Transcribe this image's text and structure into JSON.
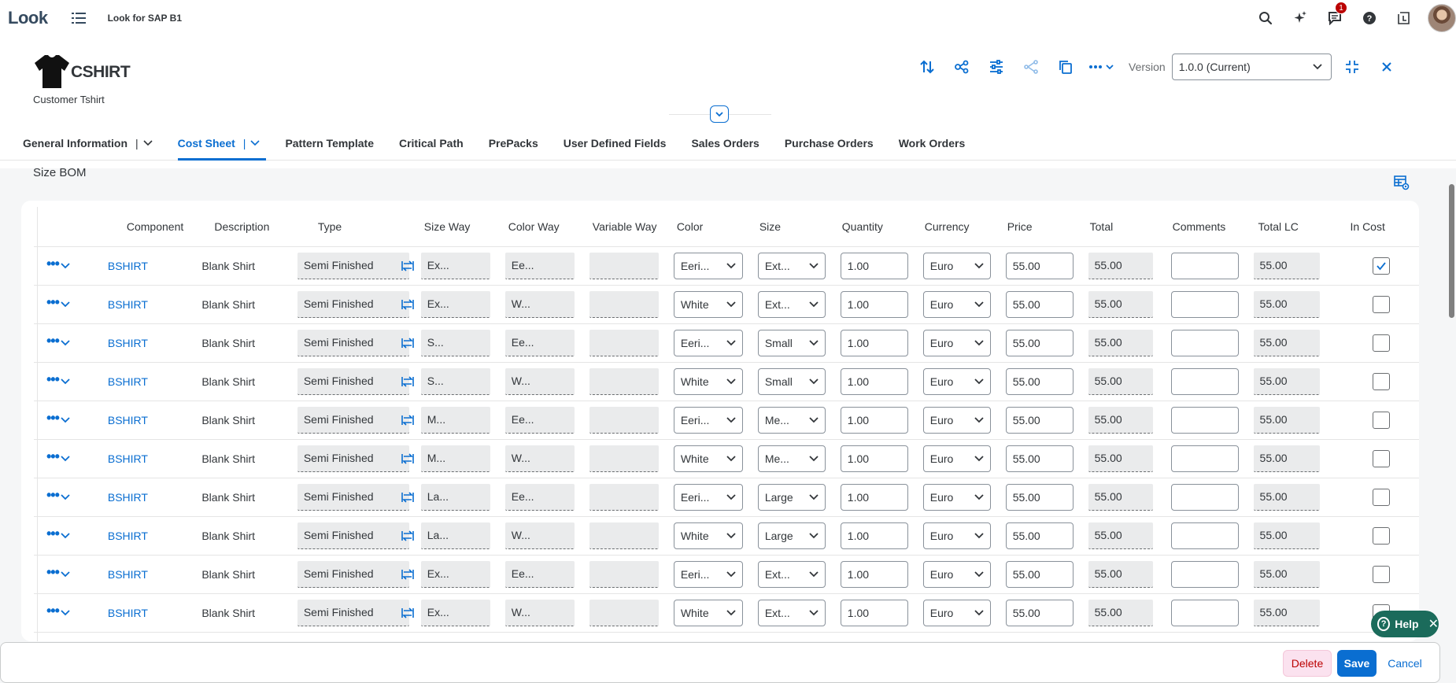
{
  "shell": {
    "logo": "Look",
    "app_title": "Look for SAP B1",
    "notification_count": "1"
  },
  "header": {
    "title": "CSHIRT",
    "subtitle": "Customer Tshirt",
    "version_label": "Version",
    "version_value": "1.0.0 (Current)"
  },
  "tabs": [
    {
      "label": "General Information",
      "has_menu": true
    },
    {
      "label": "Cost Sheet",
      "has_menu": true,
      "active": true
    },
    {
      "label": "Pattern Template"
    },
    {
      "label": "Critical Path"
    },
    {
      "label": "PrePacks"
    },
    {
      "label": "User Defined Fields"
    },
    {
      "label": "Sales Orders"
    },
    {
      "label": "Purchase Orders"
    },
    {
      "label": "Work Orders"
    }
  ],
  "section": {
    "title": "Size BOM"
  },
  "table": {
    "columns": [
      "Component",
      "Description",
      "Type",
      "Size Way",
      "Color Way",
      "Variable Way",
      "Color",
      "Size",
      "Quantity",
      "Currency",
      "Price",
      "Total",
      "Comments",
      "Total LC",
      "In Cost"
    ],
    "rows": [
      {
        "component": "BSHIRT",
        "description": "Blank Shirt",
        "type": "Semi Finished",
        "size_way": "Ex...",
        "color_way": "Ee...",
        "variable_way": "",
        "color": "Eeri...",
        "size": "Ext...",
        "quantity": "1.00",
        "currency": "Euro",
        "price": "55.00",
        "total": "55.00",
        "comments": "",
        "total_lc": "55.00",
        "in_cost": true
      },
      {
        "component": "BSHIRT",
        "description": "Blank Shirt",
        "type": "Semi Finished",
        "size_way": "Ex...",
        "color_way": "W...",
        "variable_way": "",
        "color": "White",
        "size": "Ext...",
        "quantity": "1.00",
        "currency": "Euro",
        "price": "55.00",
        "total": "55.00",
        "comments": "",
        "total_lc": "55.00",
        "in_cost": false
      },
      {
        "component": "BSHIRT",
        "description": "Blank Shirt",
        "type": "Semi Finished",
        "size_way": "S...",
        "color_way": "Ee...",
        "variable_way": "",
        "color": "Eeri...",
        "size": "Small",
        "quantity": "1.00",
        "currency": "Euro",
        "price": "55.00",
        "total": "55.00",
        "comments": "",
        "total_lc": "55.00",
        "in_cost": false
      },
      {
        "component": "BSHIRT",
        "description": "Blank Shirt",
        "type": "Semi Finished",
        "size_way": "S...",
        "color_way": "W...",
        "variable_way": "",
        "color": "White",
        "size": "Small",
        "quantity": "1.00",
        "currency": "Euro",
        "price": "55.00",
        "total": "55.00",
        "comments": "",
        "total_lc": "55.00",
        "in_cost": false
      },
      {
        "component": "BSHIRT",
        "description": "Blank Shirt",
        "type": "Semi Finished",
        "size_way": "M...",
        "color_way": "Ee...",
        "variable_way": "",
        "color": "Eeri...",
        "size": "Me...",
        "quantity": "1.00",
        "currency": "Euro",
        "price": "55.00",
        "total": "55.00",
        "comments": "",
        "total_lc": "55.00",
        "in_cost": false
      },
      {
        "component": "BSHIRT",
        "description": "Blank Shirt",
        "type": "Semi Finished",
        "size_way": "M...",
        "color_way": "W...",
        "variable_way": "",
        "color": "White",
        "size": "Me...",
        "quantity": "1.00",
        "currency": "Euro",
        "price": "55.00",
        "total": "55.00",
        "comments": "",
        "total_lc": "55.00",
        "in_cost": false
      },
      {
        "component": "BSHIRT",
        "description": "Blank Shirt",
        "type": "Semi Finished",
        "size_way": "La...",
        "color_way": "Ee...",
        "variable_way": "",
        "color": "Eeri...",
        "size": "Large",
        "quantity": "1.00",
        "currency": "Euro",
        "price": "55.00",
        "total": "55.00",
        "comments": "",
        "total_lc": "55.00",
        "in_cost": false
      },
      {
        "component": "BSHIRT",
        "description": "Blank Shirt",
        "type": "Semi Finished",
        "size_way": "La...",
        "color_way": "W...",
        "variable_way": "",
        "color": "White",
        "size": "Large",
        "quantity": "1.00",
        "currency": "Euro",
        "price": "55.00",
        "total": "55.00",
        "comments": "",
        "total_lc": "55.00",
        "in_cost": false
      },
      {
        "component": "BSHIRT",
        "description": "Blank Shirt",
        "type": "Semi Finished",
        "size_way": "Ex...",
        "color_way": "Ee...",
        "variable_way": "",
        "color": "Eeri...",
        "size": "Ext...",
        "quantity": "1.00",
        "currency": "Euro",
        "price": "55.00",
        "total": "55.00",
        "comments": "",
        "total_lc": "55.00",
        "in_cost": false
      },
      {
        "component": "BSHIRT",
        "description": "Blank Shirt",
        "type": "Semi Finished",
        "size_way": "Ex...",
        "color_way": "W...",
        "variable_way": "",
        "color": "White",
        "size": "Ext...",
        "quantity": "1.00",
        "currency": "Euro",
        "price": "55.00",
        "total": "55.00",
        "comments": "",
        "total_lc": "55.00",
        "in_cost": false
      }
    ]
  },
  "footer": {
    "delete_label": "Delete",
    "save_label": "Save",
    "cancel_label": "Cancel"
  },
  "help": {
    "label": "Help"
  },
  "colors": {
    "accent": "#0a6ed1",
    "help_bg": "#1b6b5b",
    "delete_bg": "#fbe2ef",
    "badge": "#bb0000"
  },
  "icons": {
    "shell": [
      "menu-list-icon",
      "search-icon",
      "ai-sparkle-icon",
      "notifications-icon",
      "help-circle-icon",
      "launchpad-icon"
    ],
    "actions": [
      "sort-icon",
      "share-nodes-icon",
      "filter-settings-icon",
      "branch-icon",
      "copy-icon",
      "more-icon"
    ]
  }
}
